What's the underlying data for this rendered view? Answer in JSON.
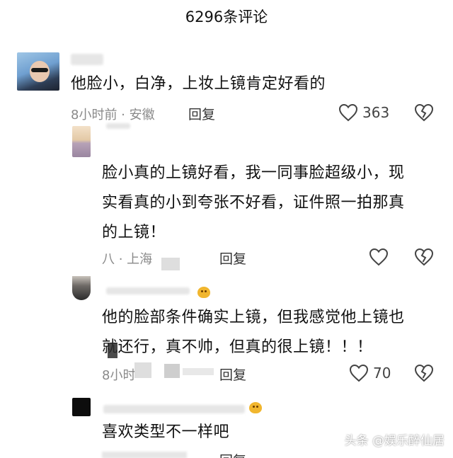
{
  "header": {
    "title": "6296条评论"
  },
  "comments": [
    {
      "username_blurred": "扭林",
      "text_lines": [
        "他脸小，白净，上妆上镜肯定好看的"
      ],
      "meta": "8小时前 · 安徽",
      "reply_label": "回复",
      "likes": "363"
    },
    {
      "text_lines": [
        "脸小真的上镜好看，我一同事脸超级小，现",
        "实看真的小到夸张不好看，证件照一拍那真",
        "的上镜！"
      ],
      "meta": "八     · 上海",
      "reply_label": "回复",
      "likes": ""
    },
    {
      "text_lines": [
        "他的脸部条件确实上镜，但我感觉他上镜也",
        "就还行，真不帅，但真的很上镜！！！"
      ],
      "meta": "8小时",
      "reply_label": "回复",
      "likes": "70"
    },
    {
      "text_lines": [
        "喜欢类型不一样吧"
      ],
      "reply_label": "回复"
    }
  ],
  "watermark": "头条 @娱乐醉仙居",
  "colors": {
    "text": "#111111",
    "meta": "#8a8a8a",
    "background": "#ffffff"
  },
  "icons": [
    "heart-icon",
    "broken-heart-icon",
    "emoji-icon"
  ]
}
